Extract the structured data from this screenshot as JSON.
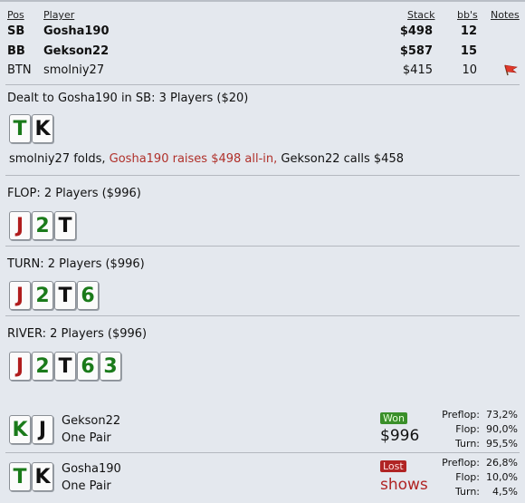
{
  "header": {
    "pos": "Pos",
    "player": "Player",
    "stack": "Stack",
    "bbs": "bb's",
    "notes": "Notes"
  },
  "players": [
    {
      "pos": "SB",
      "name": "Gosha190",
      "stack": "$498",
      "bbs": "12"
    },
    {
      "pos": "BB",
      "name": "Gekson22",
      "stack": "$587",
      "bbs": "15"
    },
    {
      "pos": "BTN",
      "name": "smolniy27",
      "stack": "$415",
      "bbs": "10"
    }
  ],
  "preflop": {
    "title": "Dealt to Gosha190 in SB: 3 Players ($20)",
    "cards": [
      {
        "rank": "T",
        "color": "green"
      },
      {
        "rank": "K",
        "color": "black"
      }
    ],
    "action_a": "smolniy27 folds, ",
    "action_b": "Gosha190 raises $498 all-in, ",
    "action_c": "Gekson22 calls $458"
  },
  "flop": {
    "title": "FLOP: 2 Players ($996)",
    "cards": [
      {
        "rank": "J",
        "color": "red"
      },
      {
        "rank": "2",
        "color": "green"
      },
      {
        "rank": "T",
        "color": "black"
      }
    ]
  },
  "turn": {
    "title": "TURN: 2 Players ($996)",
    "cards": [
      {
        "rank": "J",
        "color": "red"
      },
      {
        "rank": "2",
        "color": "green"
      },
      {
        "rank": "T",
        "color": "black"
      },
      {
        "rank": "6",
        "color": "green"
      }
    ]
  },
  "river": {
    "title": "RIVER: 2 Players ($996)",
    "cards": [
      {
        "rank": "J",
        "color": "red"
      },
      {
        "rank": "2",
        "color": "green"
      },
      {
        "rank": "T",
        "color": "black"
      },
      {
        "rank": "6",
        "color": "green"
      },
      {
        "rank": "3",
        "color": "green"
      }
    ]
  },
  "results": [
    {
      "cards": [
        {
          "rank": "K",
          "color": "green"
        },
        {
          "rank": "J",
          "color": "black"
        }
      ],
      "name": "Gekson22",
      "hand": "One Pair",
      "status": "Won",
      "amount": "$996",
      "preflop_label": "Preflop:",
      "preflop": "73,2%",
      "flop_label": "Flop:",
      "flop": "90,0%",
      "turn_label": "Turn:",
      "turn": "95,5%"
    },
    {
      "cards": [
        {
          "rank": "T",
          "color": "green"
        },
        {
          "rank": "K",
          "color": "black"
        }
      ],
      "name": "Gosha190",
      "hand": "One Pair",
      "status": "Lost",
      "amount": "shows",
      "preflop_label": "Preflop:",
      "preflop": "26,8%",
      "flop_label": "Flop:",
      "flop": "10,0%",
      "turn_label": "Turn:",
      "turn": "4,5%"
    }
  ],
  "colors": {
    "green": "#1a7a1a",
    "black": "#111111",
    "red": "#b01c1c",
    "raise": "#b0302a",
    "won": "#3a8f2a",
    "lost": "#b02424"
  },
  "icons": {
    "note": "red-flag-icon"
  }
}
